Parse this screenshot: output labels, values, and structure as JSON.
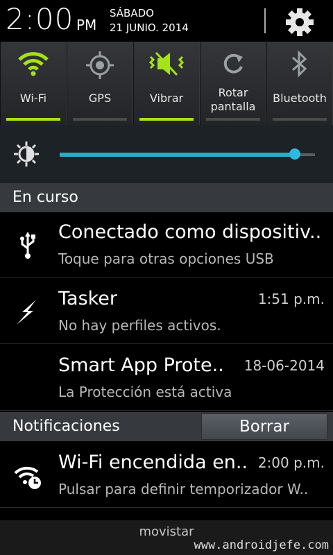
{
  "status": {
    "time": "2:00",
    "ampm": "PM",
    "day": "SÁBADO",
    "date": "21 JUNIO. 2014",
    "settings_icon": "gear-icon"
  },
  "quick_settings": [
    {
      "label": "Wi-Fi",
      "icon": "wifi-icon",
      "on": true
    },
    {
      "label": "GPS",
      "icon": "gps-icon",
      "on": false
    },
    {
      "label": "Vibrar",
      "icon": "vibrate-icon",
      "on": true
    },
    {
      "label_line1": "Rotar",
      "label_line2": "pantalla",
      "icon": "rotate-icon",
      "on": false
    },
    {
      "label": "Bluetooth",
      "icon": "bluetooth-icon",
      "on": false
    }
  ],
  "brightness": {
    "level_fraction": 0.92,
    "icon": "brightness-icon"
  },
  "ongoing": {
    "header": "En curso",
    "items": [
      {
        "title": "Conectado como dispositiv..",
        "subtitle": "Toque para otras opciones USB",
        "time": "",
        "icon": "usb-icon"
      },
      {
        "title": "Tasker",
        "subtitle": "No hay perfiles activos.",
        "time": "1:51 p.m.",
        "icon": "tasker-bolt-icon"
      },
      {
        "title": "Smart App Prote..",
        "subtitle": "La Protección está activa",
        "time": "18-06-2014",
        "icon": ""
      }
    ]
  },
  "notifications": {
    "header": "Notificaciones",
    "clear_label": "Borrar",
    "items": [
      {
        "title": "Wi-Fi encendida en..",
        "subtitle": "Pulsar para definir temporizador W..",
        "time": "2:00 p.m.",
        "icon": "wifi-timer-icon"
      }
    ]
  },
  "carrier": "movistar",
  "watermark": "www.androidjefe.com",
  "colors": {
    "accent_green": "#a6e21a",
    "accent_blue": "#2fa8cf"
  }
}
